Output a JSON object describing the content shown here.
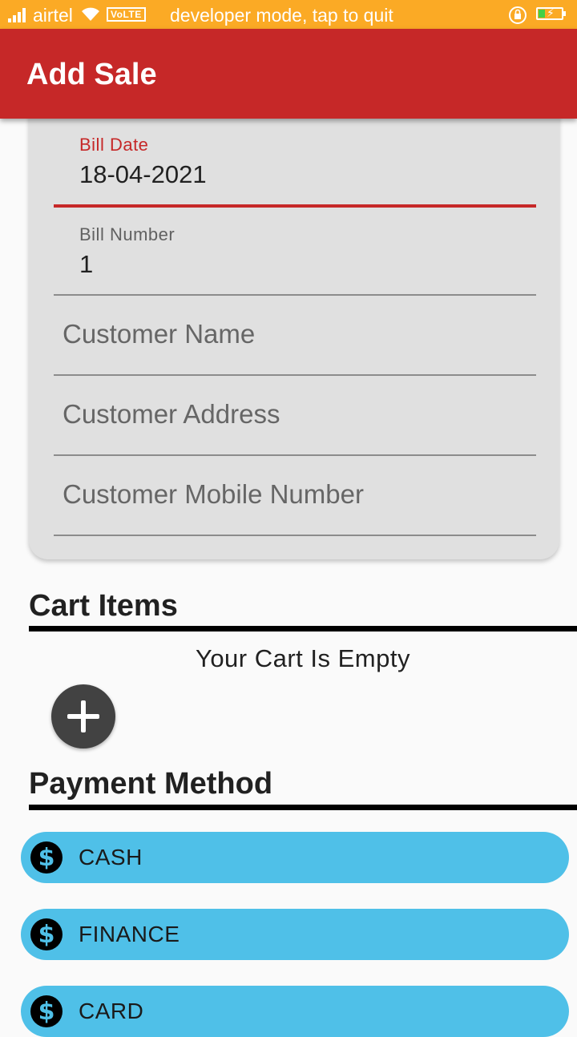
{
  "status_bar": {
    "carrier": "airtel",
    "volte": "VoLTE",
    "notice": "developer mode, tap to quit"
  },
  "app_bar": {
    "title": "Add Sale"
  },
  "form": {
    "bill_date": {
      "label": "Bill Date",
      "value": "18-04-2021"
    },
    "bill_number": {
      "label": "Bill Number",
      "value": "1"
    },
    "customer_name": {
      "placeholder": "Customer Name"
    },
    "customer_address": {
      "placeholder": "Customer Address"
    },
    "customer_mobile": {
      "placeholder": "Customer Mobile Number"
    }
  },
  "cart": {
    "title": "Cart Items",
    "empty_text": "Your Cart Is Empty"
  },
  "payment": {
    "title": "Payment Method",
    "methods": [
      {
        "label": "CASH",
        "icon": "dollar-icon"
      },
      {
        "label": "FINANCE",
        "icon": "dollar-icon"
      },
      {
        "label": "CARD",
        "icon": "dollar-icon"
      }
    ]
  },
  "colors": {
    "status_bar": "#fbaa25",
    "primary": "#c62828",
    "card": "#e0e0e0",
    "pill": "#4fc0e8",
    "fab": "#424242"
  }
}
